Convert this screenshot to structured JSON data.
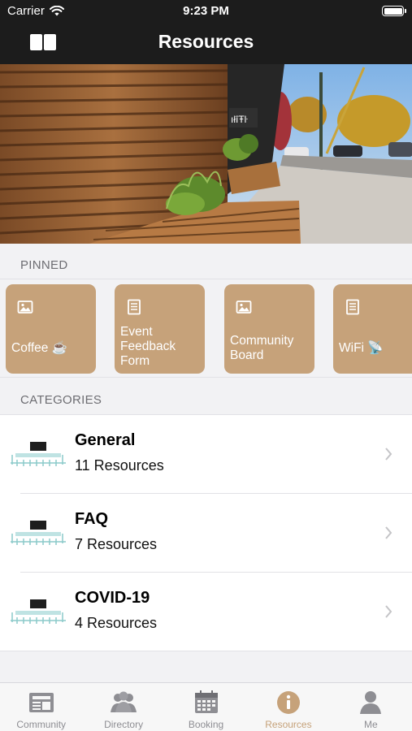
{
  "status_bar": {
    "carrier": "Carrier",
    "time": "9:23 PM"
  },
  "nav": {
    "title": "Resources"
  },
  "sections": {
    "pinned": "PINNED",
    "categories": "CATEGORIES"
  },
  "accent_color": "#c6a27a",
  "pinned": [
    {
      "label": "Coffee ☕️",
      "icon": "image-icon"
    },
    {
      "label": "Event Feedback Form",
      "icon": "document-icon"
    },
    {
      "label": "Community Board",
      "icon": "image-icon"
    },
    {
      "label": "WiFi 📡",
      "icon": "document-icon"
    }
  ],
  "categories": [
    {
      "name": "General",
      "count": "11 Resources"
    },
    {
      "name": "FAQ",
      "count": "7 Resources"
    },
    {
      "name": "COVID-19",
      "count": "4 Resources"
    }
  ],
  "tabs": [
    {
      "label": "Community",
      "icon": "newspaper-icon"
    },
    {
      "label": "Directory",
      "icon": "people-icon"
    },
    {
      "label": "Booking",
      "icon": "calendar-icon"
    },
    {
      "label": "Resources",
      "icon": "info-icon",
      "active": true
    },
    {
      "label": "Me",
      "icon": "person-icon"
    }
  ]
}
